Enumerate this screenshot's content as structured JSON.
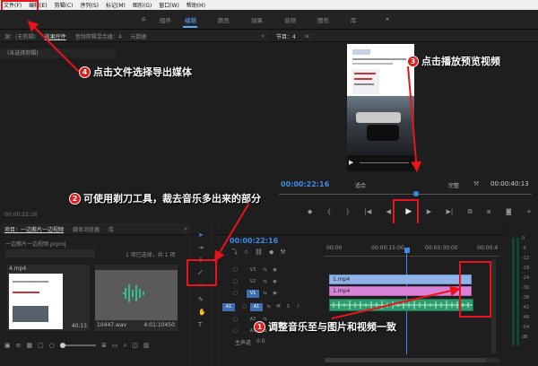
{
  "menu": [
    "文件(F)",
    "编辑(E)",
    "剪辑(C)",
    "序列(S)",
    "标记(M)",
    "图形(G)",
    "窗口(W)",
    "帮助(H)"
  ],
  "workspaces": [
    "组件",
    "编辑",
    "颜色",
    "效果",
    "音频",
    "图形",
    "库"
  ],
  "workspace_more": "»",
  "source_panel": {
    "tabs": [
      "源：(无剪辑)",
      "效果控件",
      "音频剪辑混合器：4",
      "元数据"
    ],
    "more": "»",
    "empty_label": "(未选择剪辑)",
    "timecode": "00:00:22:16"
  },
  "program": {
    "title": "节目：4",
    "menu_icon": "≡",
    "timecode": "00:00:22:16",
    "fit": "适合",
    "quality": "完整",
    "duration": "00:00:40:13"
  },
  "project": {
    "tabs": [
      "项目：一边搬片一边视频",
      "媒体浏览器",
      "库"
    ],
    "more": "»",
    "file": "一边搬片一边视频.prproj",
    "count": "1 项已选择，共 1 项",
    "clips": [
      {
        "name": "4.mp4",
        "duration": "40:13"
      },
      {
        "name": "10447.wav",
        "duration": "4:01:10450"
      }
    ]
  },
  "timeline": {
    "timecode": "00:00:22:16",
    "ruler": [
      "00:00",
      "00:00:15:00",
      "00:00:30:00",
      "00:00:4"
    ],
    "video_tracks": [
      "V3",
      "V2",
      "V1"
    ],
    "audio_tracks": [
      "A1",
      "A2",
      "A3"
    ],
    "master": "主声道",
    "master_val": "0.0",
    "clip_v2": "1.mp4",
    "clip_v1": "1.mp4",
    "audio_btns": [
      "M",
      "S"
    ]
  },
  "meter": {
    "labels": [
      "0",
      "-6",
      "-12",
      "-18",
      "-24",
      "-30",
      "-36",
      "-42",
      "-48",
      "-54",
      "dB"
    ]
  },
  "annotations": {
    "a1": {
      "num": "1",
      "text": "调整音乐至与图片和视频一致"
    },
    "a2": {
      "num": "2",
      "text": "可使用剃刀工具，裁去音乐多出来的部分"
    },
    "a3": {
      "num": "3",
      "text": "点击播放预览视频"
    },
    "a4": {
      "num": "4",
      "text": "点击文件选择导出媒体"
    }
  },
  "colors": {
    "accent": "#3f8ae6",
    "annotation": "#e8131b",
    "clip_video": "#8fb3e8",
    "clip_pink": "#d883d8",
    "clip_audio": "#2e9c6e"
  }
}
